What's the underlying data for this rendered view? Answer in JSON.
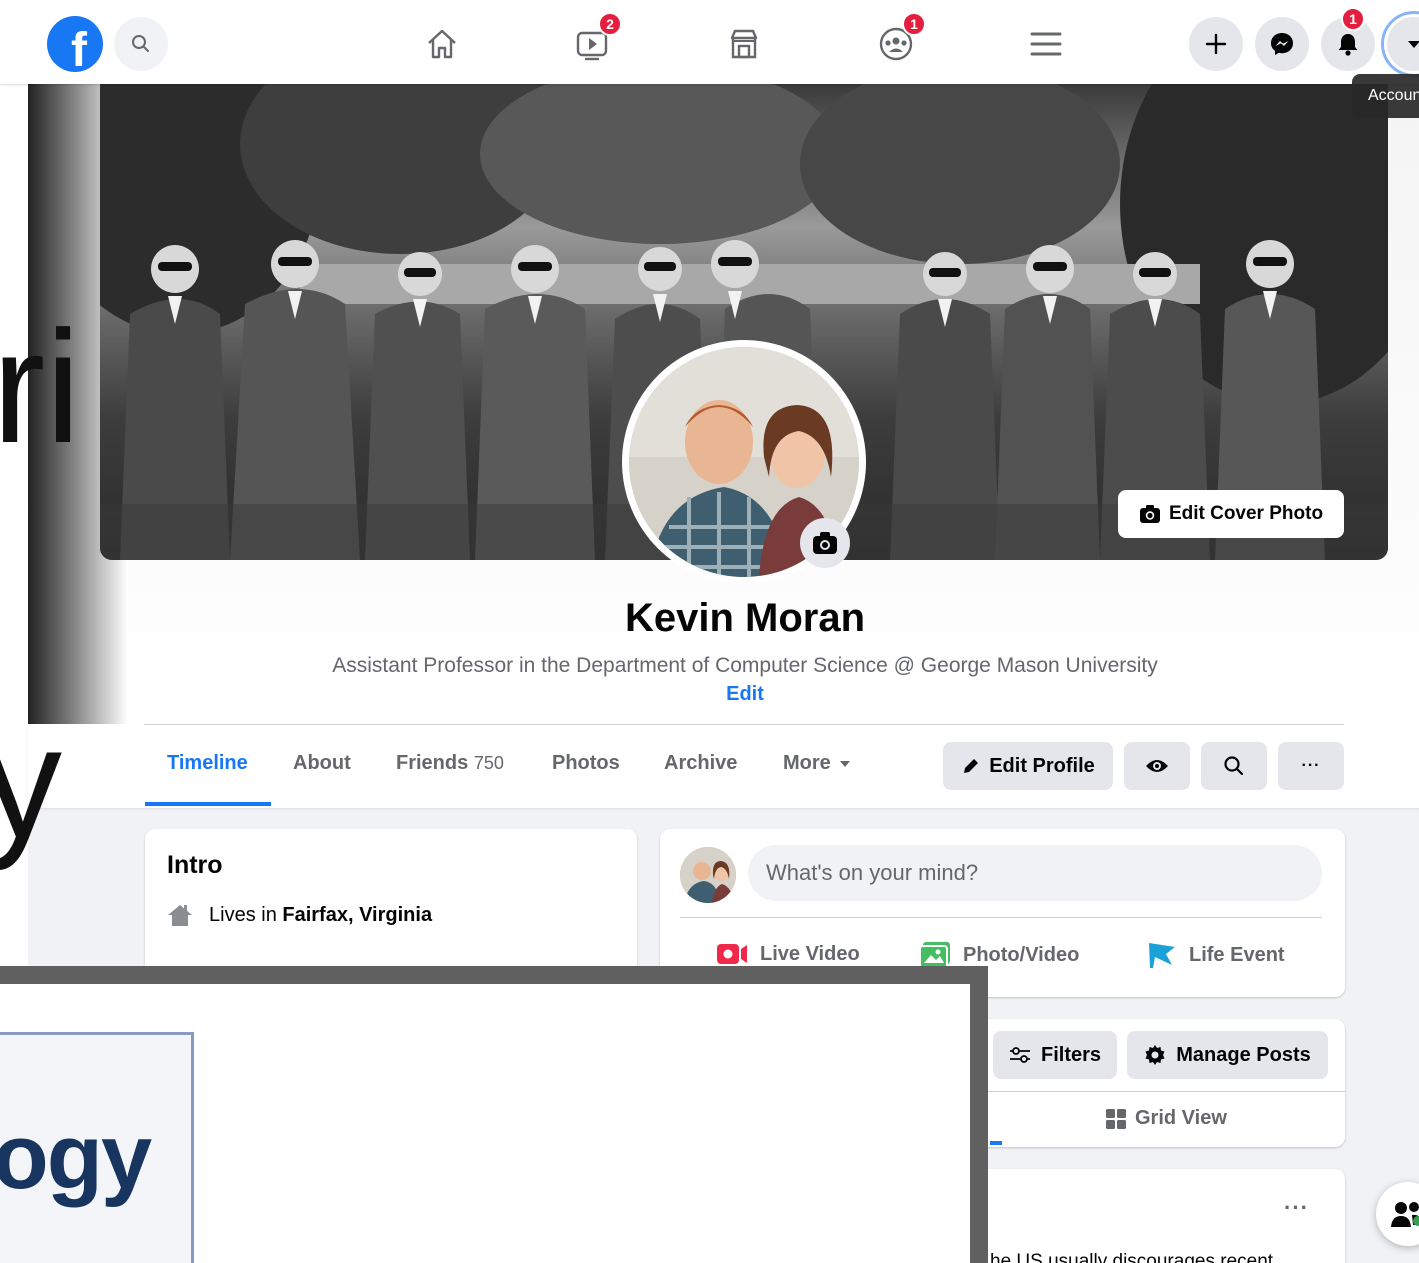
{
  "nav": {
    "logo_letter": "f",
    "watch_badge": "2",
    "groups_badge": "1",
    "notifications_badge": "1",
    "account_tooltip": "Account"
  },
  "profile": {
    "name": "Kevin Moran",
    "bio": "Assistant Professor in the Department of Computer Science @ George Mason University",
    "edit_bio": "Edit",
    "edit_cover_label": "Edit Cover Photo"
  },
  "tabs": {
    "timeline": "Timeline",
    "about": "About",
    "friends": "Friends",
    "friends_count": "750",
    "photos": "Photos",
    "archive": "Archive",
    "more": "More",
    "edit_profile": "Edit Profile",
    "more_dots": "···"
  },
  "intro": {
    "title": "Intro",
    "lives_prefix": "Lives in ",
    "lives_place": "Fairfax, Virginia"
  },
  "composer": {
    "placeholder": "What's on your mind?",
    "live_video": "Live Video",
    "photo_video": "Photo/Video",
    "life_event": "Life Event"
  },
  "posts_toolbar": {
    "filters": "Filters",
    "manage_posts": "Manage Posts",
    "grid_view": "Grid View"
  },
  "post": {
    "dots": "···",
    "text_fragment": "he US usually discourages recent"
  },
  "overlay": {
    "logo_fragment": "logy",
    "stray_left_top": "ri",
    "stray_left_bottom": "y"
  },
  "colors": {
    "brand_blue": "#1877f2",
    "badge_red": "#e41e3f",
    "page_bg": "#f0f2f5",
    "secondary_text": "#65676b"
  }
}
